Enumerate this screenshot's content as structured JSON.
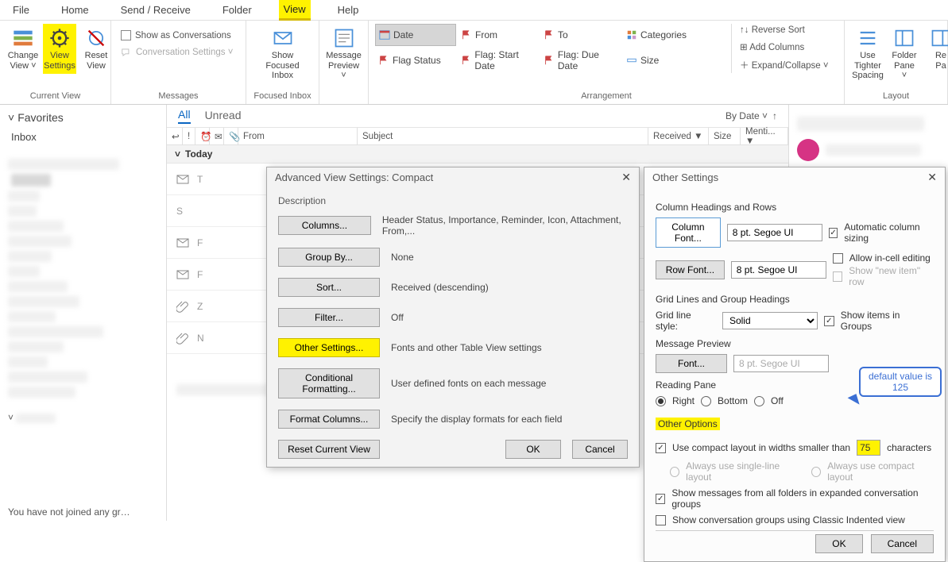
{
  "menu": [
    "File",
    "Home",
    "Send / Receive",
    "Folder",
    "View",
    "Help"
  ],
  "menu_active": "View",
  "ribbon": {
    "current_view": {
      "change": "Change\nView ˅",
      "settings": "View\nSettings",
      "reset": "Reset\nView",
      "label": "Current View"
    },
    "messages": {
      "show_as_conv": "Show as Conversations",
      "conv_settings": "Conversation Settings ˅",
      "label": "Messages"
    },
    "focused": {
      "btn": "Show Focused\nInbox",
      "label": "Focused Inbox"
    },
    "preview": {
      "btn": "Message\nPreview ˅"
    },
    "arrangement": {
      "items": [
        "Date",
        "From",
        "To",
        "Categories",
        "Flag Status",
        "Flag: Start Date",
        "Flag: Due Date",
        "Size"
      ],
      "side": [
        "↑↓ Reverse Sort",
        "⊞ Add Columns",
        "＋ Expand/Collapse ˅"
      ],
      "label": "Arrangement"
    },
    "layout": {
      "tighter": "Use Tighter\nSpacing",
      "folder": "Folder\nPane ˅",
      "reading": "Re\nPa",
      "label": "Layout"
    }
  },
  "favorites": {
    "hdr": "Favorites",
    "inbox": "Inbox"
  },
  "list": {
    "tabs": {
      "all": "All",
      "unread": "Unread"
    },
    "bydate": "By Date ˅",
    "cols": {
      "from": "From",
      "subject": "Subject",
      "received": "Received ▼",
      "size": "Size",
      "menti": "Menti... ▼"
    },
    "group_today": "Today"
  },
  "adv_dialog": {
    "title": "Advanced View Settings: Compact",
    "desc_label": "Description",
    "rows": [
      {
        "btn": "Columns...",
        "desc": "Header Status, Importance, Reminder, Icon, Attachment, From,..."
      },
      {
        "btn": "Group By...",
        "desc": "None"
      },
      {
        "btn": "Sort...",
        "desc": "Received (descending)"
      },
      {
        "btn": "Filter...",
        "desc": "Off"
      },
      {
        "btn": "Other Settings...",
        "desc": "Fonts and other Table View settings",
        "hl": true
      },
      {
        "btn": "Conditional Formatting...",
        "desc": "User defined fonts on each message"
      },
      {
        "btn": "Format Columns...",
        "desc": "Specify the display formats for each field"
      }
    ],
    "reset": "Reset Current View",
    "ok": "OK",
    "cancel": "Cancel"
  },
  "other_dialog": {
    "title": "Other Settings",
    "headings": "Column Headings and Rows",
    "col_font": "Column Font...",
    "col_font_val": "8 pt. Segoe UI",
    "row_font": "Row Font...",
    "row_font_val": "8 pt. Segoe UI",
    "auto_col": "Automatic column sizing",
    "in_cell": "Allow in-cell editing",
    "new_item": "Show \"new item\" row",
    "grid": "Grid Lines and Group Headings",
    "grid_style": "Grid line style:",
    "grid_val": "Solid",
    "show_groups": "Show items in Groups",
    "msg_preview": "Message Preview",
    "font_btn": "Font...",
    "font_val": "8 pt. Segoe UI",
    "reading": "Reading Pane",
    "r_right": "Right",
    "r_bottom": "Bottom",
    "r_off": "Off",
    "other_opts": "Other Options",
    "compact1": "Use compact layout in widths smaller than",
    "compact_val": "75",
    "compact2": "characters",
    "single": "Always use single-line layout",
    "always_compact": "Always use compact layout",
    "show_all": "Show messages from all folders in expanded conversation groups",
    "classic": "Show conversation groups using Classic Indented view",
    "ok": "OK",
    "cancel": "Cancel",
    "callout": "default value is\n125"
  },
  "bottom": "You have not joined any gr…"
}
